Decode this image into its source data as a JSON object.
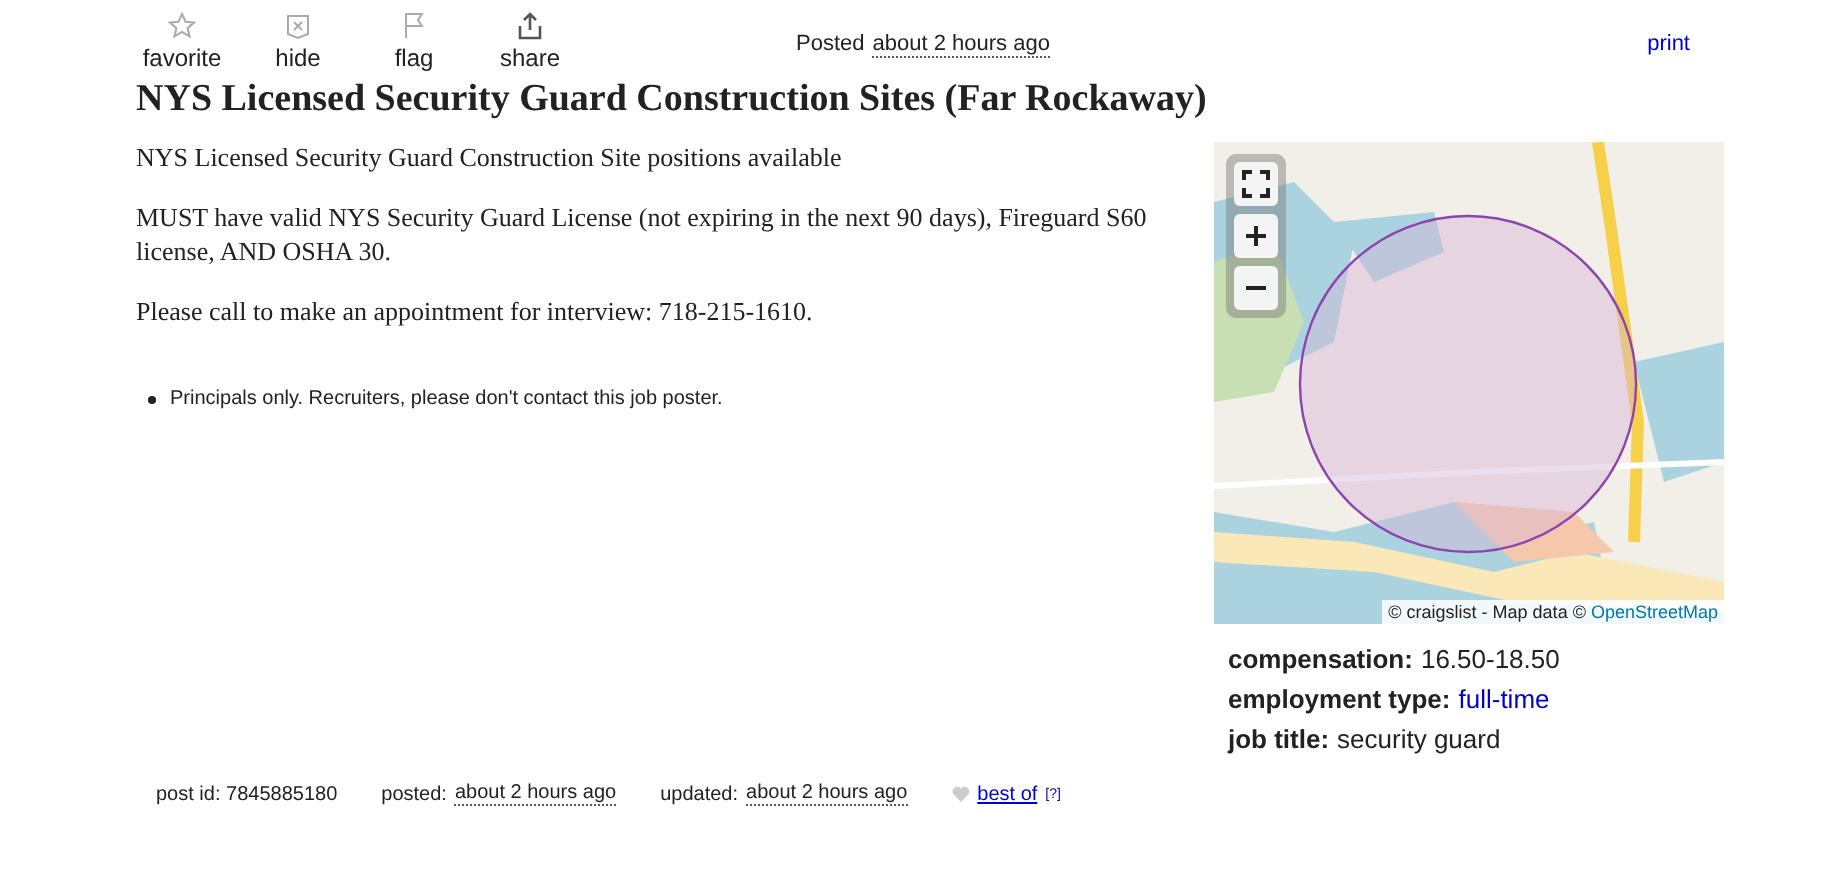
{
  "toolbar": [
    {
      "kind": "star",
      "label": "favorite"
    },
    {
      "kind": "hide",
      "label": "hide"
    },
    {
      "kind": "flag",
      "label": "flag"
    },
    {
      "kind": "share",
      "label": "share"
    }
  ],
  "posted": {
    "label": "Posted",
    "time": "about 2 hours ago"
  },
  "print_link": "print",
  "title": "NYS Licensed Security Guard Construction Sites (Far Rockaway)",
  "body": [
    "NYS Licensed Security Guard Construction Site positions available",
    "MUST have valid NYS Security Guard License (not expiring in the next 90 days), Fireguard S60 license, AND OSHA 30.",
    "Please call to make an appointment for interview: 718-215-1610."
  ],
  "notices": [
    "Principals only. Recruiters, please don't contact this job poster."
  ],
  "map": {
    "controls": [
      {
        "kind": "fullscreen"
      },
      {
        "kind": "zoom-in"
      },
      {
        "kind": "zoom-out"
      }
    ],
    "attribution": "© craigslist - Map data ©",
    "attribution_link": "OpenStreetMap"
  },
  "attributes": [
    {
      "label": "compensation:",
      "value": "16.50-18.50",
      "link": false
    },
    {
      "label": "employment type:",
      "value": "full-time",
      "link": true
    },
    {
      "label": "job title:",
      "value": "security guard",
      "link": false
    }
  ],
  "footer": {
    "post_id": "post id: 7845885180",
    "posted_label": "posted:",
    "posted_time": "about 2 hours ago",
    "updated_label": "updated:",
    "updated_time": "about 2 hours ago",
    "best_of": "best of",
    "help": "[?]"
  }
}
